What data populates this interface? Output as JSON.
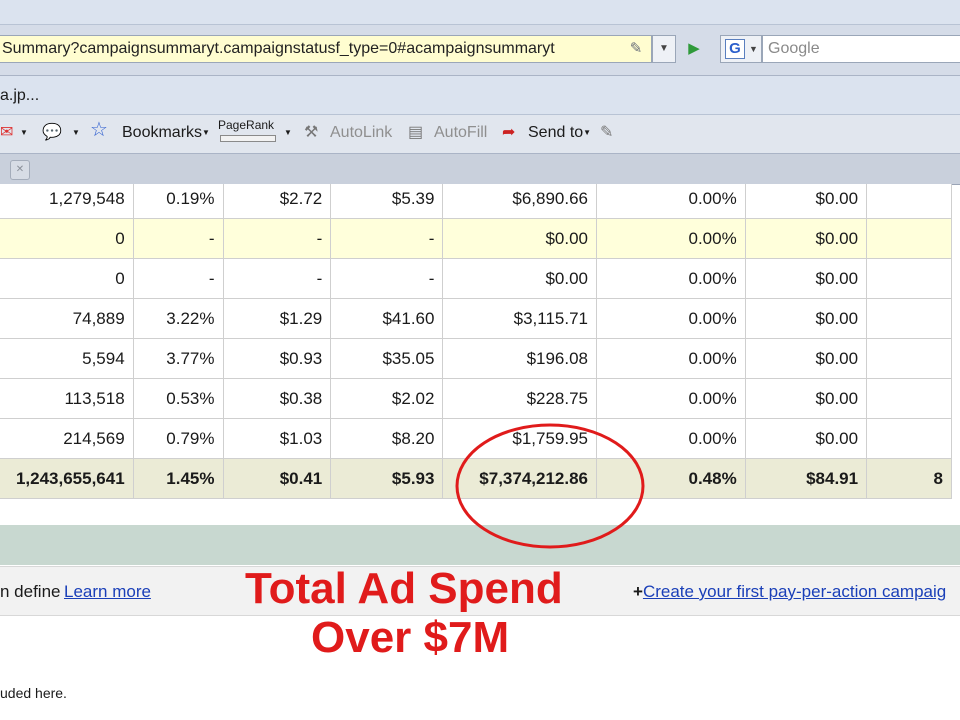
{
  "browser": {
    "url": "Summary?campaignsummaryt.campaignstatusf_type=0#acampaignsummaryt",
    "search_placeholder": "Google",
    "bookmark_fragment": "a.jp...",
    "toolbar": {
      "bookmarks_label": "Bookmarks",
      "pagerank_label": "PageRank",
      "autolink_label": "AutoLink",
      "autofill_label": "AutoFill",
      "sendto_label": "Send to"
    }
  },
  "table": {
    "rows": [
      {
        "style": "white",
        "cells": [
          "1,279,548",
          "0.19%",
          "$2.72",
          "$5.39",
          "$6,890.66",
          "0.00%",
          "$0.00",
          ""
        ]
      },
      {
        "style": "yellow",
        "cells": [
          "0",
          "-",
          "-",
          "-",
          "$0.00",
          "0.00%",
          "$0.00",
          ""
        ]
      },
      {
        "style": "white",
        "cells": [
          "0",
          "-",
          "-",
          "-",
          "$0.00",
          "0.00%",
          "$0.00",
          ""
        ]
      },
      {
        "style": "white",
        "cells": [
          "74,889",
          "3.22%",
          "$1.29",
          "$41.60",
          "$3,115.71",
          "0.00%",
          "$0.00",
          ""
        ]
      },
      {
        "style": "white",
        "cells": [
          "5,594",
          "3.77%",
          "$0.93",
          "$35.05",
          "$196.08",
          "0.00%",
          "$0.00",
          ""
        ]
      },
      {
        "style": "white",
        "cells": [
          "113,518",
          "0.53%",
          "$0.38",
          "$2.02",
          "$228.75",
          "0.00%",
          "$0.00",
          ""
        ]
      },
      {
        "style": "white",
        "cells": [
          "214,569",
          "0.79%",
          "$1.03",
          "$8.20",
          "$1,759.95",
          "0.00%",
          "$0.00",
          ""
        ]
      }
    ],
    "total": [
      "1,243,655,641",
      "1.45%",
      "$0.41",
      "$5.93",
      "$7,374,212.86",
      "0.48%",
      "$84.91",
      "8"
    ]
  },
  "footer": {
    "define_text": "n define",
    "learn_more": "Learn more",
    "create_plus": "+",
    "create_link": "Create your first pay-per-action campaig",
    "bottom_note": "uded here."
  },
  "annotation": {
    "line1": "Total Ad Spend",
    "line2": "Over $7M",
    "color": "#e01b1b"
  }
}
